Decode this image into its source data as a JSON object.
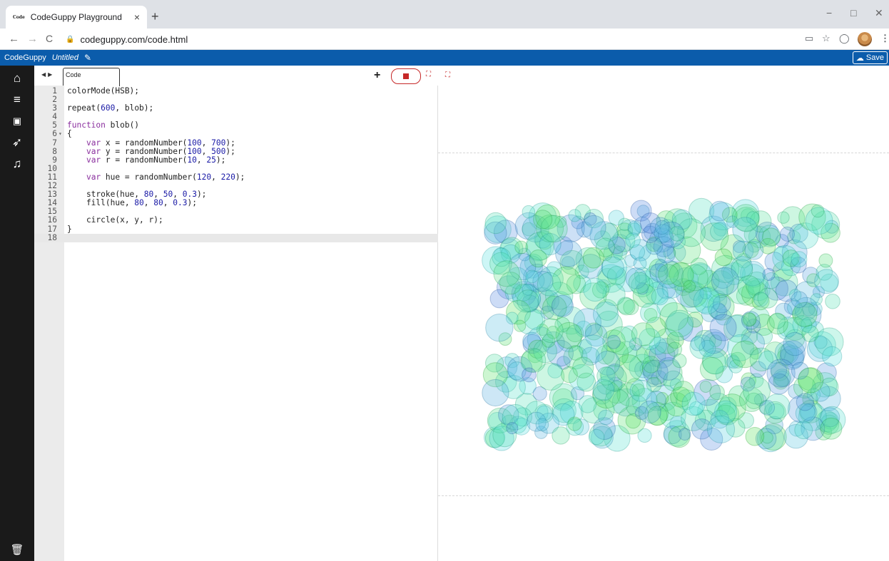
{
  "browser": {
    "tab_title": "CodeGuppy Playground",
    "tab_favicon": "Code",
    "tab_close": "×",
    "new_tab": "+",
    "url": "codeguppy.com/code.html",
    "window_controls": [
      "−",
      "□",
      "✕"
    ]
  },
  "appbar": {
    "brand": "CodeGuppy",
    "project_name": "Untitled",
    "save_label": "Save",
    "bg_color": "#0b5cab"
  },
  "sidebar": {
    "icons": [
      "home-icon",
      "menu-icon",
      "image-icon",
      "rocket-icon",
      "music-icon",
      "trash-icon"
    ]
  },
  "editor": {
    "tab_label": "Code",
    "add_label": "+",
    "lines": [
      {
        "n": "1",
        "text": "colorMode(HSB);"
      },
      {
        "n": "2",
        "text": ""
      },
      {
        "n": "3",
        "text": "repeat(600, blob);"
      },
      {
        "n": "4",
        "text": ""
      },
      {
        "n": "5",
        "text": "function blob()"
      },
      {
        "n": "6",
        "text": "{"
      },
      {
        "n": "7",
        "text": "    var x = randomNumber(100, 700);"
      },
      {
        "n": "8",
        "text": "    var y = randomNumber(100, 500);"
      },
      {
        "n": "9",
        "text": "    var r = randomNumber(10, 25);"
      },
      {
        "n": "10",
        "text": ""
      },
      {
        "n": "11",
        "text": "    var hue = randomNumber(120, 220);"
      },
      {
        "n": "12",
        "text": ""
      },
      {
        "n": "13",
        "text": "    stroke(hue, 80, 50, 0.3);"
      },
      {
        "n": "14",
        "text": "    fill(hue, 80, 80, 0.3);"
      },
      {
        "n": "15",
        "text": ""
      },
      {
        "n": "16",
        "text": "    circle(x, y, r);"
      },
      {
        "n": "17",
        "text": "}"
      },
      {
        "n": "18",
        "text": ""
      }
    ],
    "active_line": 18,
    "fold_line": 6
  },
  "output": {
    "blob_count": 600,
    "hue_range": [
      120,
      220
    ],
    "radius_range": [
      10,
      25
    ],
    "x_range": [
      100,
      700
    ],
    "y_range": [
      100,
      500
    ]
  }
}
